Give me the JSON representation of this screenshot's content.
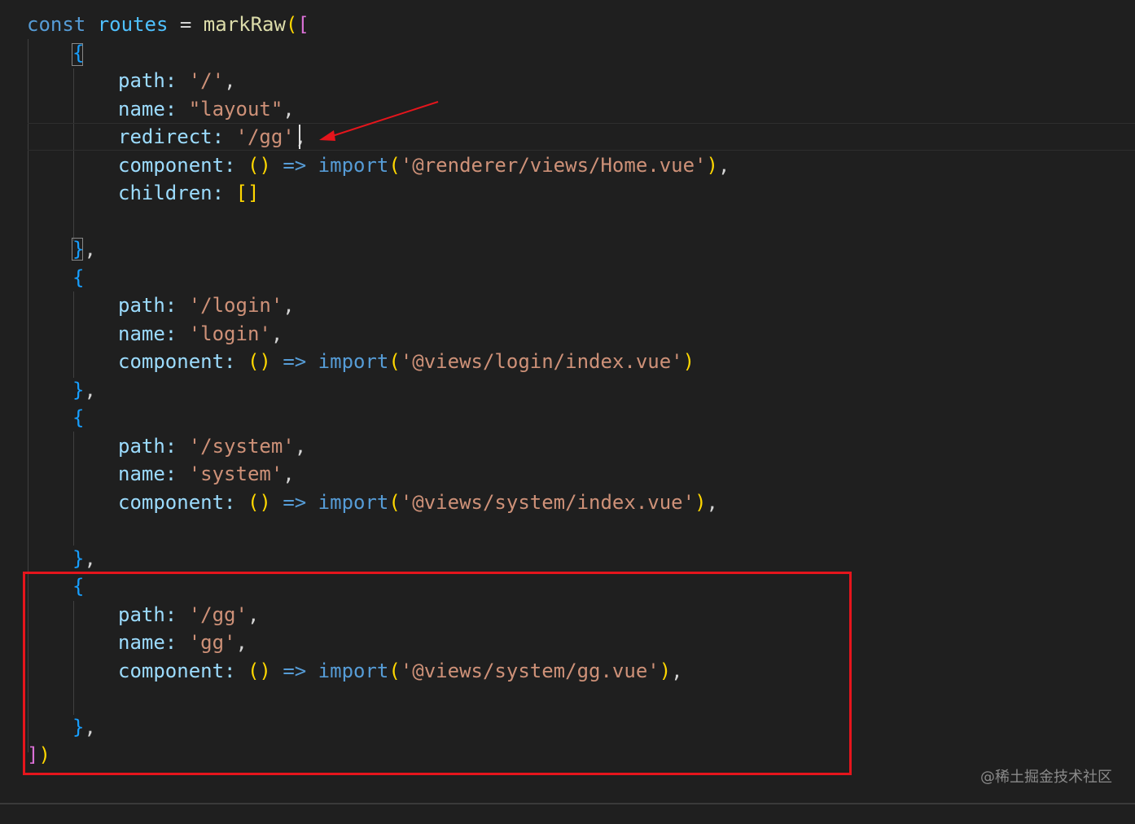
{
  "watermark": "@稀土掘金技术社区",
  "colors": {
    "background": "#1f1f1f",
    "keyword": "#569cd6",
    "variable": "#4fc1ff",
    "function": "#dcdcaa",
    "property": "#9cdcfe",
    "string": "#ce9178",
    "bracket_level1": "#ffd700",
    "bracket_level2": "#da70d6",
    "bracket_level3": "#179fff",
    "highlight_box": "#e5151c",
    "annotation_arrow": "#e5151c"
  },
  "code": {
    "header": {
      "kw": "const",
      "var": "routes",
      "eq": " = ",
      "fn": "markRaw",
      "p_open": "(",
      "b_open": "["
    },
    "r1": {
      "open": "{",
      "path_key": "path:",
      "path_val": "'/'",
      "path_comma": ",",
      "name_key": "name:",
      "name_val": "\"layout\"",
      "name_comma": ",",
      "redirect_key": "redirect:",
      "redirect_val": "'/gg'",
      "redirect_comma": ",",
      "comp_key": "component:",
      "comp_parens": "()",
      "comp_arrow": "=>",
      "comp_import": "import",
      "comp_p_open": "(",
      "comp_val": "'@renderer/views/Home.vue'",
      "comp_p_close": ")",
      "comp_comma": ",",
      "children_key": "children:",
      "children_val": "[]",
      "close": "}",
      "close_comma": ","
    },
    "r2": {
      "open": "{",
      "path_key": "path:",
      "path_val": "'/login'",
      "path_comma": ",",
      "name_key": "name:",
      "name_val": "'login'",
      "name_comma": ",",
      "comp_key": "component:",
      "comp_parens": "()",
      "comp_arrow": "=>",
      "comp_import": "import",
      "comp_p_open": "(",
      "comp_val": "'@views/login/index.vue'",
      "comp_p_close": ")",
      "close": "}",
      "close_comma": ","
    },
    "r3": {
      "open": "{",
      "path_key": "path:",
      "path_val": "'/system'",
      "path_comma": ",",
      "name_key": "name:",
      "name_val": "'system'",
      "name_comma": ",",
      "comp_key": "component:",
      "comp_parens": "()",
      "comp_arrow": "=>",
      "comp_import": "import",
      "comp_p_open": "(",
      "comp_val": "'@views/system/index.vue'",
      "comp_p_close": ")",
      "comp_comma": ",",
      "close": "}",
      "close_comma": ","
    },
    "r4": {
      "open": "{",
      "path_key": "path:",
      "path_val": "'/gg'",
      "path_comma": ",",
      "name_key": "name:",
      "name_val": "'gg'",
      "name_comma": ",",
      "comp_key": "component:",
      "comp_parens": "()",
      "comp_arrow": "=>",
      "comp_import": "import",
      "comp_p_open": "(",
      "comp_val": "'@views/system/gg.vue'",
      "comp_p_close": ")",
      "comp_comma": ",",
      "close": "}",
      "close_comma": ","
    },
    "footer": {
      "b_close": "]",
      "p_close": ")"
    }
  }
}
